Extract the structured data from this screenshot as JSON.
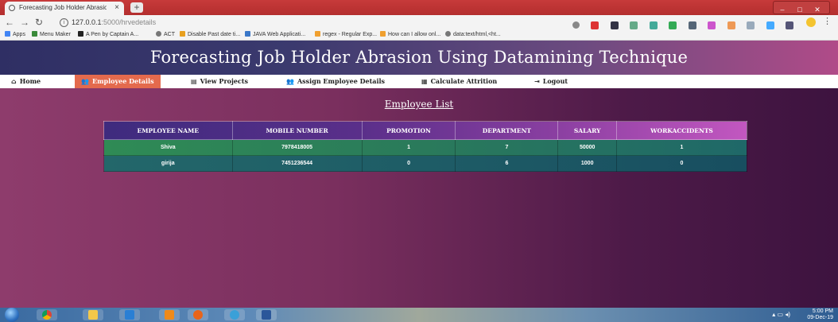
{
  "browser": {
    "tab_title": "Forecasting Job Holder Abrasion",
    "tab_close": "×",
    "new_tab": "+",
    "url_host": "127.0.0.1",
    "url_path": ":5000/hrvedetails",
    "window_controls": [
      "–",
      "□",
      "✕"
    ],
    "bookmarks": [
      {
        "label": "Apps",
        "color": "#4285f4"
      },
      {
        "label": "Menu Maker",
        "color": "#3a8a3a"
      },
      {
        "label": "A Pen by Captain A...",
        "color": "#222222"
      },
      {
        "label": "ACT",
        "color": "#777777"
      },
      {
        "label": "Disable Past date ti...",
        "color": "#e8a020"
      },
      {
        "label": "JAVA Web Applicati...",
        "color": "#3b78c8"
      },
      {
        "label": "regex - Regular Exp...",
        "color": "#f0a030"
      },
      {
        "label": "How can I allow onl...",
        "color": "#f0a030"
      },
      {
        "label": "data:text/html,<ht...",
        "color": "#777777"
      }
    ]
  },
  "header": {
    "title": "Forecasting Job Holder Abrasion Using Datamining Technique"
  },
  "nav": {
    "items": [
      {
        "label": "Home",
        "icon": "home-icon",
        "active": false
      },
      {
        "label": "Employee Details",
        "icon": "users-icon",
        "active": true
      },
      {
        "label": "View Projects",
        "icon": "file-icon",
        "active": false
      },
      {
        "label": "Assign Employee Details",
        "icon": "users-icon",
        "active": false
      },
      {
        "label": "Calculate Attrition",
        "icon": "calculator-icon",
        "active": false
      },
      {
        "label": "Logout",
        "icon": "logout-icon",
        "active": false
      }
    ]
  },
  "main": {
    "list_title": "Employee List",
    "table": {
      "columns": [
        "EMPLOYEE NAME",
        "MOBILE NUMBER",
        "PROMOTION",
        "DEPARTMENT",
        "SALARY",
        "WORKACCIDENTS"
      ],
      "rows": [
        [
          "Shiva",
          "7978418005",
          "1",
          "7",
          "50000",
          "1"
        ],
        [
          "girija",
          "7451236544",
          "0",
          "6",
          "1000",
          "0"
        ]
      ]
    }
  },
  "taskbar": {
    "time": "5:00 PM",
    "date": "09-Dec-19"
  },
  "colors": {
    "active_nav": "#e46a4d",
    "row_green": "#2f8b55",
    "row_teal": "#1e5c66",
    "header_purple": "#5a2f8a"
  }
}
